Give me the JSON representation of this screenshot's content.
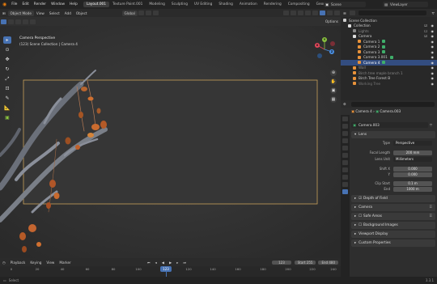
{
  "topbar": {
    "menus": [
      "File",
      "Edit",
      "Render",
      "Window",
      "Help"
    ],
    "workspaces": [
      "Layout.001",
      "Texture Paint.001",
      "Modeling",
      "Sculpting",
      "UV Editing",
      "Shading",
      "Animation",
      "Rendering",
      "Compositing",
      "Geometry Nodes",
      "Scr"
    ],
    "active_workspace": "Layout.001",
    "scene": "Scene",
    "view_layer": "ViewLayer"
  },
  "viewport_header": {
    "mode": "Object Mode",
    "menus": [
      "View",
      "Select",
      "Add",
      "Object"
    ],
    "orientation": "Global",
    "options": "Options"
  },
  "viewport": {
    "camera_title": "Camera Perspective",
    "camera_subtitle": "(123) Scene Collection | Camera 4",
    "background": "#3a3a3a",
    "frame_color": "#c8a05a"
  },
  "toolbar": {
    "tools": [
      "select-box",
      "cursor",
      "move",
      "rotate",
      "scale",
      "transform",
      "annotate",
      "measure",
      "add-cube"
    ]
  },
  "nav_gizmo": {
    "axes": [
      "X",
      "Y",
      "Z"
    ],
    "colors": {
      "x": "#e2475a",
      "y": "#8bc43f",
      "z": "#4a8fe3"
    }
  },
  "outliner": {
    "header_title": "Scene Collection",
    "rows": [
      {
        "label": "Scene Collection",
        "indent": 0,
        "kind": "collection"
      },
      {
        "label": "Collection",
        "indent": 1,
        "kind": "collection"
      },
      {
        "label": "Lights",
        "indent": 2,
        "kind": "collection"
      },
      {
        "label": "Camera",
        "indent": 2,
        "kind": "collection"
      },
      {
        "label": "Camera 1",
        "indent": 3,
        "kind": "camera"
      },
      {
        "label": "Camera 2",
        "indent": 3,
        "kind": "camera"
      },
      {
        "label": "Camera 3",
        "indent": 3,
        "kind": "camera"
      },
      {
        "label": "Camera 3.001",
        "indent": 3,
        "kind": "camera"
      },
      {
        "label": "Camera 4",
        "indent": 3,
        "kind": "camera",
        "selected": true
      },
      {
        "label": "Wall",
        "indent": 2,
        "kind": "mesh"
      },
      {
        "label": "Birch tree maple branch 1",
        "indent": 2,
        "kind": "mesh"
      },
      {
        "label": "Birch Tree Forest B",
        "indent": 2,
        "kind": "mesh"
      },
      {
        "label": "Working Tree",
        "indent": 2,
        "kind": "mesh"
      }
    ]
  },
  "properties": {
    "breadcrumb_object": "Camera 4",
    "breadcrumb_data": "Camera.003",
    "datablock_name": "Camera.003",
    "lens_panel": "Lens",
    "type_label": "Type",
    "type_value": "Perspective",
    "focal_length_label": "Focal Length",
    "focal_length_value": "200 mm",
    "lens_unit_label": "Lens Unit",
    "lens_unit_value": "Millimeters",
    "shift_x_label": "Shift X",
    "shift_x_value": "0.000",
    "shift_y_label": "Y",
    "shift_y_value": "0.000",
    "clip_start_label": "Clip Start",
    "clip_start_value": "0.1 m",
    "clip_end_label": "End",
    "clip_end_value": "1000 m",
    "panels": [
      "Depth of Field",
      "Camera",
      "Safe Areas",
      "Background Images",
      "Viewport Display",
      "Custom Properties"
    ]
  },
  "timeline": {
    "menus": [
      "Playback",
      "Keying",
      "View",
      "Marker"
    ],
    "current_frame": "123",
    "start_label": "Start",
    "start_value": "255",
    "end_label": "End",
    "end_value": "480",
    "ticks": [
      "0",
      "20",
      "40",
      "60",
      "80",
      "100",
      "120",
      "140",
      "160",
      "180",
      "200",
      "220",
      "240",
      "260"
    ],
    "playhead_label": "123"
  },
  "statusbar": {
    "left": "Select",
    "right": "3.3.1"
  },
  "colors": {
    "accent": "#4772b3",
    "leaf": "#c0602a",
    "branch": "#8a8f9a"
  }
}
